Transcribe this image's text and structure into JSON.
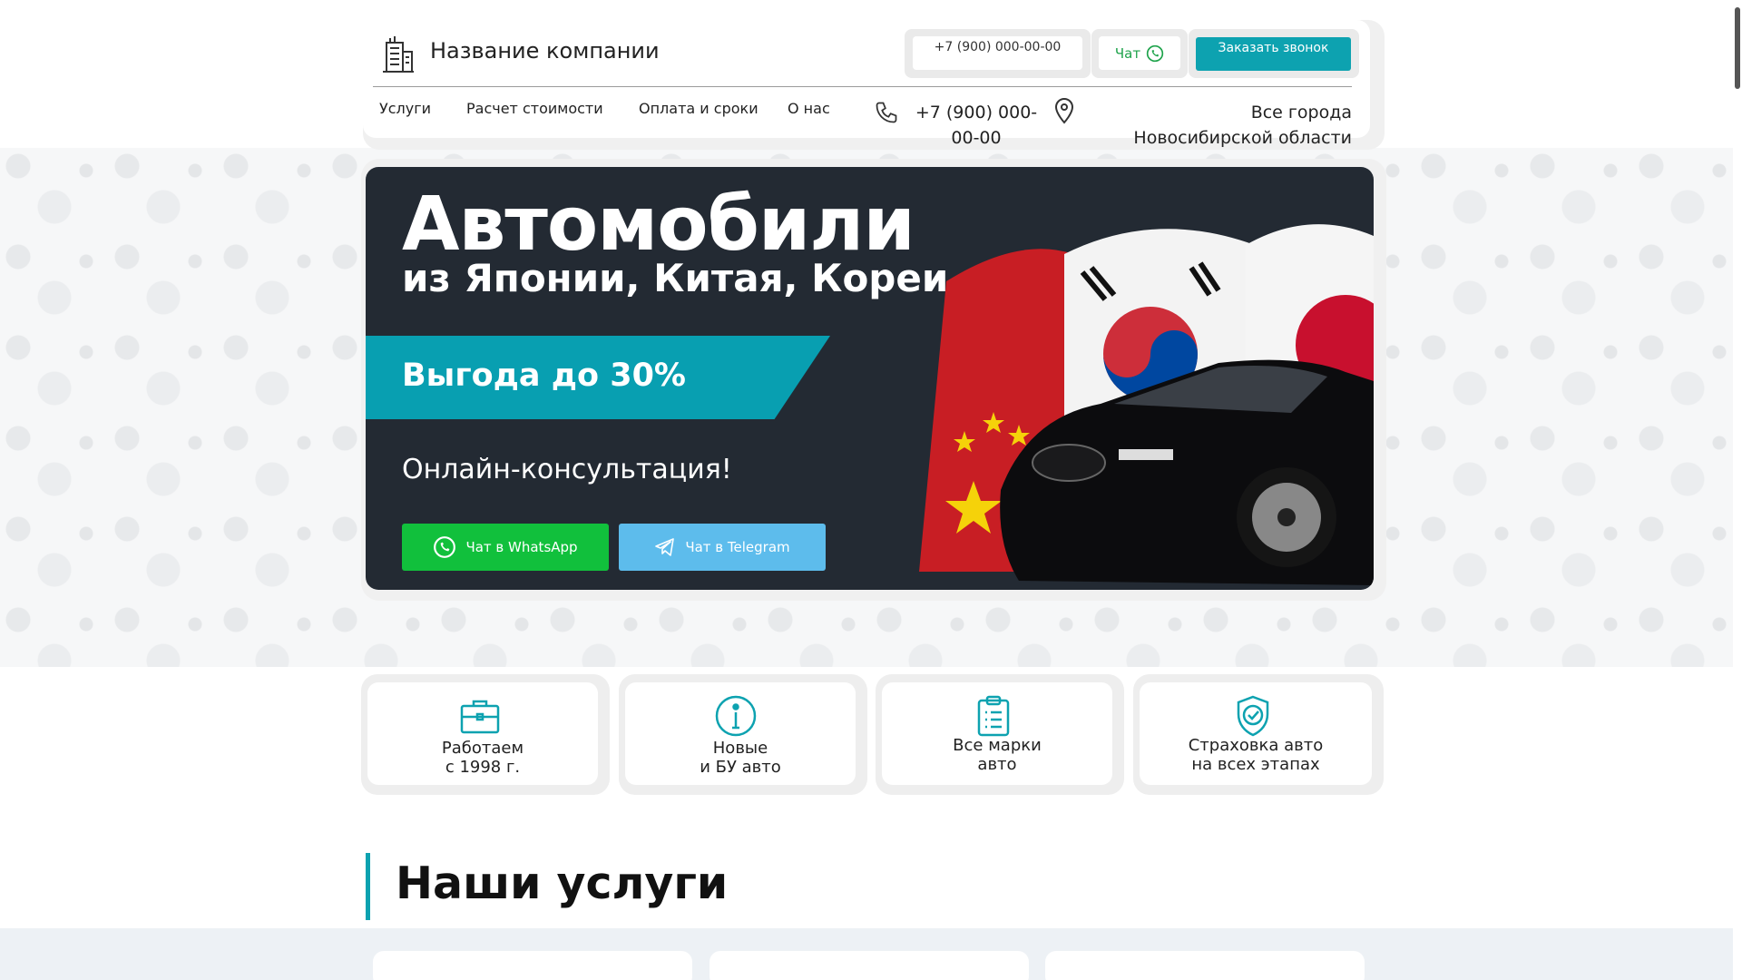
{
  "header": {
    "company": "Название компании",
    "phone_top": "+7 (900) 000-00-00",
    "chat": "Чат",
    "callback": "Заказать звонок",
    "nav": [
      "Услуги",
      "Расчет стоимости",
      "Оплата и сроки",
      "О нас"
    ],
    "phone": "+7 (900) 000-00-00",
    "city": "Все города Новосибирской области"
  },
  "hero": {
    "title": "Автомобили",
    "subtitle": "из Японии, Китая, Кореи",
    "promo": "Выгода до 30%",
    "consult": "Онлайн-консультация!",
    "whatsapp_button": "Чат в WhatsApp",
    "telegram_button": "Чат в Telegram"
  },
  "features": [
    {
      "line1": "Работаем",
      "line2": "с 1998 г.",
      "icon": "briefcase-icon"
    },
    {
      "line1": "Новые",
      "line2": "и БУ авто",
      "icon": "info-icon"
    },
    {
      "line1": "Все марки",
      "line2": "авто",
      "icon": "clipboard-icon"
    },
    {
      "line1": "Страховка авто",
      "line2": "на всех этапах",
      "icon": "shield-check-icon"
    }
  ],
  "services": {
    "title": "Наши услуги"
  },
  "colors": {
    "accent": "#0da2b0",
    "whatsapp": "#11c03c",
    "telegram": "#5dbcec",
    "hero_bg": "#232a33"
  }
}
